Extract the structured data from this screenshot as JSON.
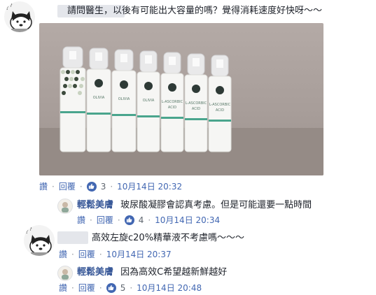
{
  "comments": [
    {
      "text": "請問醫生，以後有可能出大容量的嗎？覺得消耗速度好快呀～～",
      "actions": {
        "read": "讚",
        "reply": "回覆",
        "likes": "3",
        "date": "10月14日 20:32"
      },
      "photo": {
        "bottle_brand": "OLIVIA",
        "bottle_line1": "L-ASCORBIC",
        "bottle_line2": "ACID"
      },
      "reply": {
        "author": "輕鬆美膚",
        "text": "玻尿酸凝膠會認真考慮。但是可能還要一點時間",
        "actions": {
          "read": "讚",
          "reply": "回覆",
          "likes": "4",
          "date": "10月14日 20:34"
        }
      }
    },
    {
      "text": "高效左旋c20%精華液不考慮嗎～～～",
      "actions": {
        "read": "讚",
        "reply": "回覆",
        "date": "10月14日 20:37"
      },
      "reply": {
        "author": "輕鬆美膚",
        "text": "因為高效C希望越新鮮越好",
        "actions": {
          "read": "讚",
          "reply": "回覆",
          "likes": "5",
          "date": "10月14日 20:48"
        }
      }
    }
  ],
  "colors": {
    "link": "#4267b2",
    "author": "#385898",
    "like_badge": "#4267b2",
    "meta": "#606770"
  },
  "icons": [
    "dog-avatar-icon",
    "like-thumb-icon",
    "brand-avatar-icon"
  ]
}
